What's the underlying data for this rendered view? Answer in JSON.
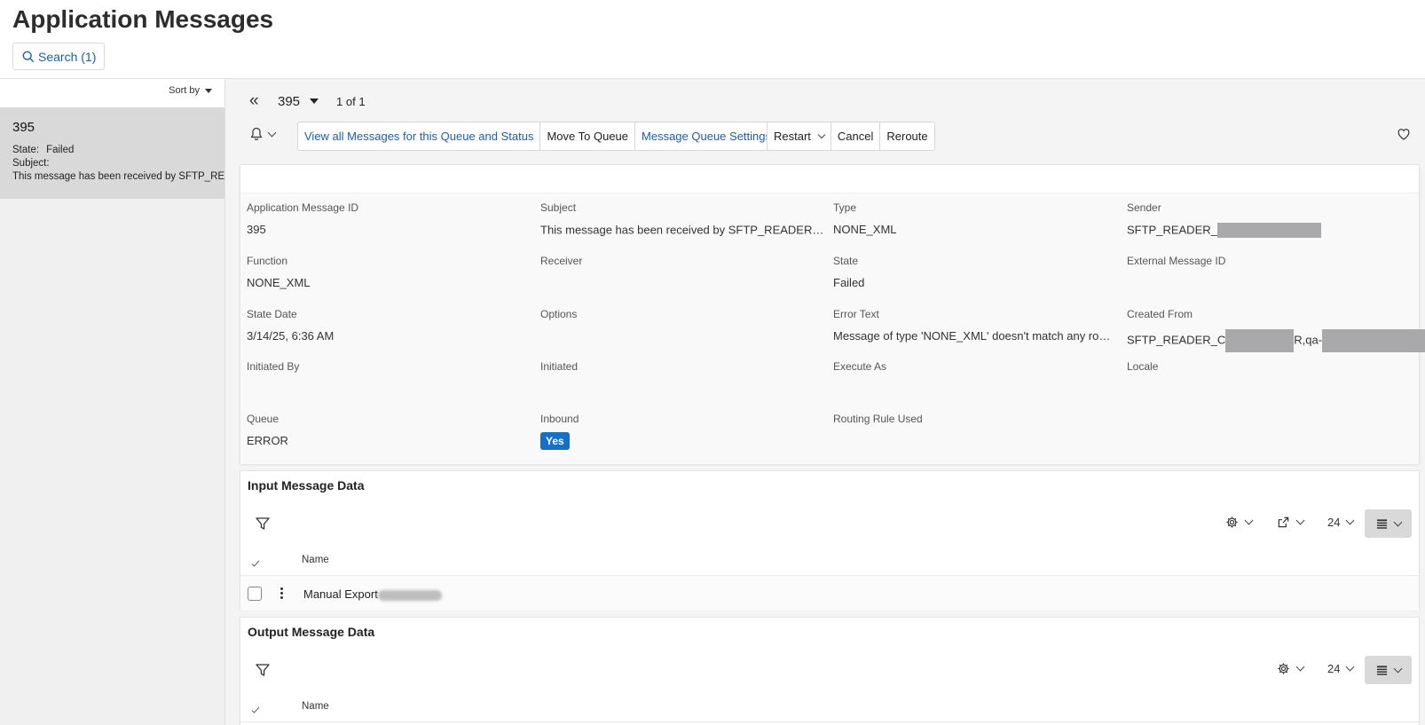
{
  "header": {
    "title": "Application Messages",
    "search_label": "Search (1)"
  },
  "sidebar": {
    "sort_label": "Sort by",
    "item": {
      "id": "395",
      "state_label": "State:",
      "state_value": "Failed",
      "subject_label": "Subject:",
      "subject_value": "This message has been received by SFTP_READER_C"
    }
  },
  "navigator": {
    "current_id": "395",
    "count": "1 of 1"
  },
  "toolbar": {
    "group1": [
      "View all Messages for this Queue and Status",
      "Move To Queue",
      "Message Queue Settings"
    ],
    "restart": "Restart",
    "cancel": "Cancel",
    "reroute": "Reroute"
  },
  "details": {
    "app_msg_id_label": "Application Message ID",
    "app_msg_id": "395",
    "subject_label": "Subject",
    "subject": "This message has been received by SFTP_READER_C",
    "type_label": "Type",
    "type": "NONE_XML",
    "sender_label": "Sender",
    "sender": "SFTP_READER_",
    "function_label": "Function",
    "function": "NONE_XML",
    "receiver_label": "Receiver",
    "receiver": "",
    "state_label": "State",
    "state": "Failed",
    "external_id_label": "External Message ID",
    "external_id": "",
    "state_date_label": "State Date",
    "state_date": "3/14/25, 6:36 AM",
    "options_label": "Options",
    "options": "",
    "error_text_label": "Error Text",
    "error_text": "Message of type 'NONE_XML' doesn't match any routing rule",
    "created_from_label": "Created From",
    "created_from_a": "SFTP_READER_C",
    "created_from_b": "R,qa-",
    "initiated_by_label": "Initiated By",
    "initiated_label": "Initiated",
    "execute_as_label": "Execute As",
    "locale_label": "Locale",
    "queue_label": "Queue",
    "queue": "ERROR",
    "inbound_label": "Inbound",
    "inbound": "Yes",
    "routing_rule_label": "Routing Rule Used"
  },
  "input_data": {
    "title": "Input Message Data",
    "page_size": "24",
    "column_name": "Name",
    "rows": [
      {
        "name": "Manual Export"
      }
    ]
  },
  "output_data": {
    "title": "Output Message Data",
    "page_size": "24",
    "column_name": "Name"
  },
  "colors": {
    "link": "#1a5fa8",
    "badge": "#1670c6",
    "selected_item": "#d9d9d9"
  }
}
